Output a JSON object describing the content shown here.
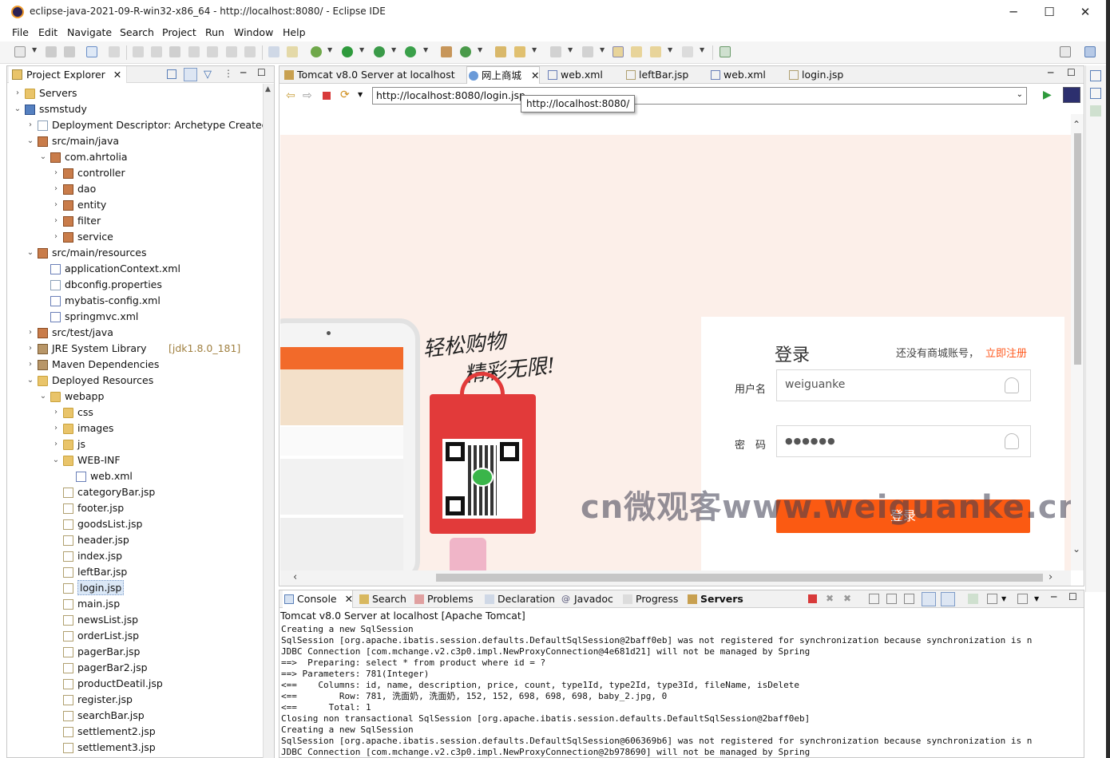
{
  "window": {
    "title": "eclipse-java-2021-09-R-win32-x86_64 - http://localhost:8080/ - Eclipse IDE",
    "minimize": "─",
    "maximize": "☐",
    "close": "✕"
  },
  "menu": [
    "File",
    "Edit",
    "Navigate",
    "Search",
    "Project",
    "Run",
    "Window",
    "Help"
  ],
  "project_explorer": {
    "tab_label": "Project Explorer",
    "items": [
      {
        "label": "Servers",
        "extra": "",
        "indent": 0,
        "arrow": "›",
        "icon": "folder"
      },
      {
        "label": "ssmstudy",
        "extra": "",
        "indent": 0,
        "arrow": "⌄",
        "icon": "proj"
      },
      {
        "label": "Deployment Descriptor: Archetype Created W",
        "extra": "",
        "indent": 1,
        "arrow": "›",
        "icon": "file"
      },
      {
        "label": "src/main/java",
        "extra": "",
        "indent": 1,
        "arrow": "⌄",
        "icon": "pkg"
      },
      {
        "label": "com.ahrtolia",
        "extra": "",
        "indent": 2,
        "arrow": "⌄",
        "icon": "pkg"
      },
      {
        "label": "controller",
        "extra": "",
        "indent": 3,
        "arrow": "›",
        "icon": "pkg"
      },
      {
        "label": "dao",
        "extra": "",
        "indent": 3,
        "arrow": "›",
        "icon": "pkg"
      },
      {
        "label": "entity",
        "extra": "",
        "indent": 3,
        "arrow": "›",
        "icon": "pkg"
      },
      {
        "label": "filter",
        "extra": "",
        "indent": 3,
        "arrow": "›",
        "icon": "pkg"
      },
      {
        "label": "service",
        "extra": "",
        "indent": 3,
        "arrow": "›",
        "icon": "pkg"
      },
      {
        "label": "src/main/resources",
        "extra": "",
        "indent": 1,
        "arrow": "⌄",
        "icon": "pkg"
      },
      {
        "label": "applicationContext.xml",
        "extra": "",
        "indent": 2,
        "arrow": "",
        "icon": "xml"
      },
      {
        "label": "dbconfig.properties",
        "extra": "",
        "indent": 2,
        "arrow": "",
        "icon": "file"
      },
      {
        "label": "mybatis-config.xml",
        "extra": "",
        "indent": 2,
        "arrow": "",
        "icon": "xml"
      },
      {
        "label": "springmvc.xml",
        "extra": "",
        "indent": 2,
        "arrow": "",
        "icon": "xml"
      },
      {
        "label": "src/test/java",
        "extra": "",
        "indent": 1,
        "arrow": "›",
        "icon": "pkg"
      },
      {
        "label": "JRE System Library ",
        "extra": "[jdk1.8.0_181]",
        "indent": 1,
        "arrow": "›",
        "icon": "jar"
      },
      {
        "label": "Maven Dependencies",
        "extra": "",
        "indent": 1,
        "arrow": "›",
        "icon": "jar"
      },
      {
        "label": "Deployed Resources",
        "extra": "",
        "indent": 1,
        "arrow": "⌄",
        "icon": "folder"
      },
      {
        "label": "webapp",
        "extra": "",
        "indent": 2,
        "arrow": "⌄",
        "icon": "folder"
      },
      {
        "label": "css",
        "extra": "",
        "indent": 3,
        "arrow": "›",
        "icon": "folder"
      },
      {
        "label": "images",
        "extra": "",
        "indent": 3,
        "arrow": "›",
        "icon": "folder"
      },
      {
        "label": "js",
        "extra": "",
        "indent": 3,
        "arrow": "›",
        "icon": "folder"
      },
      {
        "label": "WEB-INF",
        "extra": "",
        "indent": 3,
        "arrow": "⌄",
        "icon": "folder"
      },
      {
        "label": "web.xml",
        "extra": "",
        "indent": 4,
        "arrow": "",
        "icon": "xml"
      },
      {
        "label": "categoryBar.jsp",
        "extra": "",
        "indent": 3,
        "arrow": "",
        "icon": "jsp"
      },
      {
        "label": "footer.jsp",
        "extra": "",
        "indent": 3,
        "arrow": "",
        "icon": "jsp"
      },
      {
        "label": "goodsList.jsp",
        "extra": "",
        "indent": 3,
        "arrow": "",
        "icon": "jsp"
      },
      {
        "label": "header.jsp",
        "extra": "",
        "indent": 3,
        "arrow": "",
        "icon": "jsp"
      },
      {
        "label": "index.jsp",
        "extra": "",
        "indent": 3,
        "arrow": "",
        "icon": "jsp"
      },
      {
        "label": "leftBar.jsp",
        "extra": "",
        "indent": 3,
        "arrow": "",
        "icon": "jsp"
      },
      {
        "label": "login.jsp",
        "extra": "",
        "indent": 3,
        "arrow": "",
        "icon": "jsp",
        "selected": true
      },
      {
        "label": "main.jsp",
        "extra": "",
        "indent": 3,
        "arrow": "",
        "icon": "jsp"
      },
      {
        "label": "newsList.jsp",
        "extra": "",
        "indent": 3,
        "arrow": "",
        "icon": "jsp"
      },
      {
        "label": "orderList.jsp",
        "extra": "",
        "indent": 3,
        "arrow": "",
        "icon": "jsp"
      },
      {
        "label": "pagerBar.jsp",
        "extra": "",
        "indent": 3,
        "arrow": "",
        "icon": "jsp"
      },
      {
        "label": "pagerBar2.jsp",
        "extra": "",
        "indent": 3,
        "arrow": "",
        "icon": "jsp"
      },
      {
        "label": "productDeatil.jsp",
        "extra": "",
        "indent": 3,
        "arrow": "",
        "icon": "jsp"
      },
      {
        "label": "register.jsp",
        "extra": "",
        "indent": 3,
        "arrow": "",
        "icon": "jsp"
      },
      {
        "label": "searchBar.jsp",
        "extra": "",
        "indent": 3,
        "arrow": "",
        "icon": "jsp"
      },
      {
        "label": "settlement2.jsp",
        "extra": "",
        "indent": 3,
        "arrow": "",
        "icon": "jsp"
      },
      {
        "label": "settlement3.jsp",
        "extra": "",
        "indent": 3,
        "arrow": "",
        "icon": "jsp"
      }
    ]
  },
  "editor_tabs": [
    {
      "label": "Tomcat v8.0 Server at localhost",
      "active": false
    },
    {
      "label": "网上商城",
      "active": true,
      "close": "✕"
    },
    {
      "label": "web.xml",
      "active": false
    },
    {
      "label": "leftBar.jsp",
      "active": false
    },
    {
      "label": "web.xml",
      "active": false
    },
    {
      "label": "login.jsp",
      "active": false
    }
  ],
  "browser": {
    "url": "http://localhost:8080/login.jsp",
    "tooltip": "http://localhost:8080/"
  },
  "webpage": {
    "slogan_line1": "轻松购物",
    "slogan_line2": "精彩无限!",
    "login_title": "登录",
    "no_account_hint": "还没有商城账号，",
    "register_link": "立即注册",
    "username_label": "用户名",
    "username_value": "weiguanke",
    "password_label": "密　码",
    "password_value": "●●●●●●",
    "login_button": "登录",
    "watermark": "cn微观客www.weiguanke.cn",
    "accent_color": "#fb5a12"
  },
  "console": {
    "tabs": [
      "Console",
      "Search",
      "Problems",
      "Declaration",
      "Javadoc",
      "Progress",
      "Servers"
    ],
    "header": "Tomcat v8.0 Server at localhost [Apache Tomcat]",
    "lines": [
      "Creating a new SqlSession",
      "SqlSession [org.apache.ibatis.session.defaults.DefaultSqlSession@2baff0eb] was not registered for synchronization because synchronization is n",
      "JDBC Connection [com.mchange.v2.c3p0.impl.NewProxyConnection@4e681d21] will not be managed by Spring",
      "==>  Preparing: select * from product where id = ?",
      "==> Parameters: 781(Integer)",
      "<==    Columns: id, name, description, price, count, type1Id, type2Id, type3Id, fileName, isDelete",
      "<==        Row: 781, 洗面奶, 洗面奶, 152, 152, 698, 698, 698, baby_2.jpg, 0",
      "<==      Total: 1",
      "Closing non transactional SqlSession [org.apache.ibatis.session.defaults.DefaultSqlSession@2baff0eb]",
      "Creating a new SqlSession",
      "SqlSession [org.apache.ibatis.session.defaults.DefaultSqlSession@606369b6] was not registered for synchronization because synchronization is n",
      "JDBC Connection [com.mchange.v2.c3p0.impl.NewProxyConnection@2b978690] will not be managed by Spring"
    ]
  }
}
